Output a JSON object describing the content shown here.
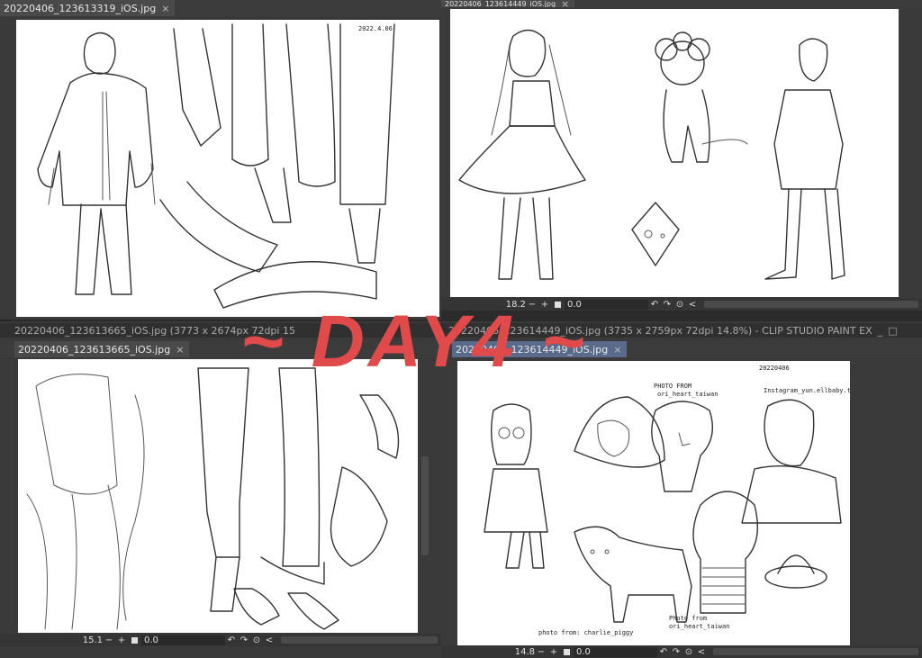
{
  "overlay": {
    "title": "~ DAY4 ~",
    "color": "#e04a4a"
  },
  "windows": [
    {
      "tab_label": "20220406_123613319_iOS.jpg",
      "close": "×",
      "statusbar": {
        "zoom": "",
        "angle": ""
      }
    },
    {
      "tab_label": "20220406_123614449_iOS.jpg",
      "close": "×",
      "statusbar": {
        "zoom": "18.2",
        "angle": "0.0"
      }
    },
    {
      "title_text": "20220406_123613665_iOS.jpg (3773 x 2674px 72dpi 15",
      "tab_label": "20220406_123613665_iOS.jpg",
      "close": "×",
      "statusbar": {
        "zoom": "15.1",
        "angle": "0.0"
      }
    },
    {
      "title_text": "20220406_123614449_iOS.jpg (3735 x 2759px 72dpi 14.8%)  - CLIP STUDIO PAINT EX",
      "tab_label": "20220406_123614449_iOS.jpg",
      "close": "×",
      "statusbar": {
        "zoom": "14.8",
        "angle": "0.0"
      }
    }
  ],
  "sketch_notes": {
    "date": "2022.4.06",
    "date2": "20220406",
    "photo_from_1": "PHOTO FROM",
    "photo_from_1b": "ori_heart_taiwan",
    "instagram": "Instagram_yun.ellbaby.tw",
    "photo_from_2": "photo from: charlie_piggy",
    "photo_from_3": "Photo from",
    "photo_from_3b": "ori_heart_taiwan"
  },
  "statusbar_icons": {
    "minus": "−",
    "plus": "+",
    "rotate_left": "↶",
    "rotate_right": "↷",
    "reset": "⊙",
    "left_arrow": "<"
  },
  "window_controls": {
    "minimize": "_",
    "maximize": "□"
  }
}
